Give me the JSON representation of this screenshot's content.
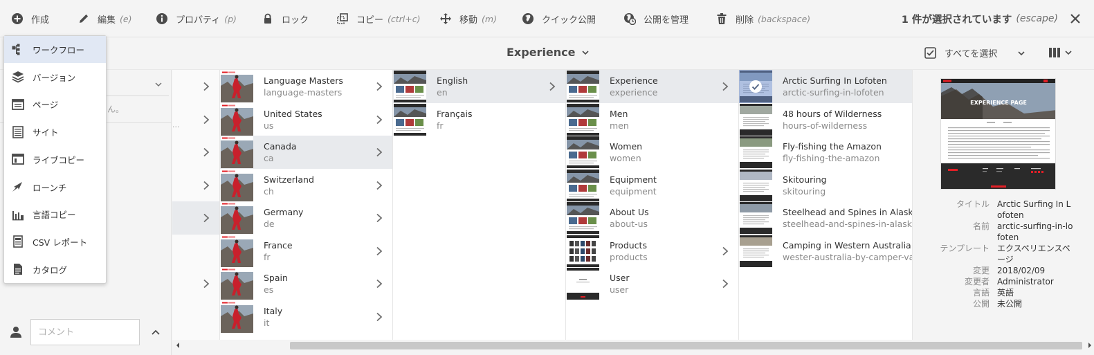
{
  "actionbar": {
    "create": "作成",
    "edit": "編集",
    "edit_sc": "(e)",
    "properties": "プロパティ",
    "properties_sc": "(p)",
    "lock": "ロック",
    "copy": "コピー",
    "copy_sc": "(ctrl+c)",
    "move": "移動",
    "move_sc": "(m)",
    "quick_publish": "クイック公開",
    "manage_publication": "公開を管理",
    "delete": "削除",
    "delete_sc": "(backspace)",
    "selection_status": "1 件が選択されています",
    "selection_sc": "(escape)"
  },
  "header": {
    "breadcrumb": "Experience",
    "select_all": "すべてを選択"
  },
  "rail": {
    "empty_hint": "ん。",
    "ellipsis": "...",
    "comment_placeholder": "コメント"
  },
  "create_menu": {
    "items": [
      {
        "label": "ワークフロー",
        "icon": "workflow-icon"
      },
      {
        "label": "バージョン",
        "icon": "versions-icon"
      },
      {
        "label": "ページ",
        "icon": "page-icon"
      },
      {
        "label": "サイト",
        "icon": "site-icon"
      },
      {
        "label": "ライブコピー",
        "icon": "live-copy-icon"
      },
      {
        "label": "ローンチ",
        "icon": "launch-icon"
      },
      {
        "label": "言語コピー",
        "icon": "language-copy-icon"
      },
      {
        "label": "CSV レポート",
        "icon": "csv-report-icon"
      },
      {
        "label": "カタログ",
        "icon": "catalog-icon"
      }
    ]
  },
  "columns": {
    "regions": [
      {
        "title": "Language Masters",
        "name": "language-masters"
      },
      {
        "title": "United States",
        "name": "us"
      },
      {
        "title": "Canada",
        "name": "ca"
      },
      {
        "title": "Switzerland",
        "name": "ch"
      },
      {
        "title": "Germany",
        "name": "de"
      },
      {
        "title": "France",
        "name": "fr"
      },
      {
        "title": "Spain",
        "name": "es"
      },
      {
        "title": "Italy",
        "name": "it"
      }
    ],
    "languages": [
      {
        "title": "English",
        "name": "en"
      },
      {
        "title": "Français",
        "name": "fr"
      }
    ],
    "sections": [
      {
        "title": "Experience",
        "name": "experience"
      },
      {
        "title": "Men",
        "name": "men"
      },
      {
        "title": "Women",
        "name": "women"
      },
      {
        "title": "Equipment",
        "name": "equipment"
      },
      {
        "title": "About Us",
        "name": "about-us"
      },
      {
        "title": "Products",
        "name": "products"
      },
      {
        "title": "User",
        "name": "user"
      }
    ],
    "pages": [
      {
        "title": "Arctic Surfing In Lofoten",
        "name": "arctic-surfing-in-lofoten"
      },
      {
        "title": "48 hours of Wilderness",
        "name": "hours-of-wilderness"
      },
      {
        "title": "Fly-fishing the Amazon",
        "name": "fly-fishing-the-amazon"
      },
      {
        "title": "Skitouring",
        "name": "skitouring"
      },
      {
        "title": "Steelhead and Spines in Alaska",
        "name": "steelhead-and-spines-in-alaska"
      },
      {
        "title": "Camping in Western Australia",
        "name": "wester-australia-by-camper-van"
      }
    ]
  },
  "preview": {
    "thumb_caption": "EXPERIENCE PAGE",
    "meta": [
      {
        "key": "タイトル",
        "value": "Arctic Surfing In Lofoten"
      },
      {
        "key": "名前",
        "value": "arctic-surfing-in-lofoten"
      },
      {
        "key": "テンプレート",
        "value": "エクスペリエンスページ"
      },
      {
        "key": "変更",
        "value": "2018/02/09"
      },
      {
        "key": "変更者",
        "value": "Administrator"
      },
      {
        "key": "言語",
        "value": "英語"
      },
      {
        "key": "公開",
        "value": "未公開"
      }
    ]
  },
  "colors": {
    "selected_row": "#e8eaed",
    "menu_active": "#e1e8f4",
    "brand_red": "#e21f26"
  }
}
